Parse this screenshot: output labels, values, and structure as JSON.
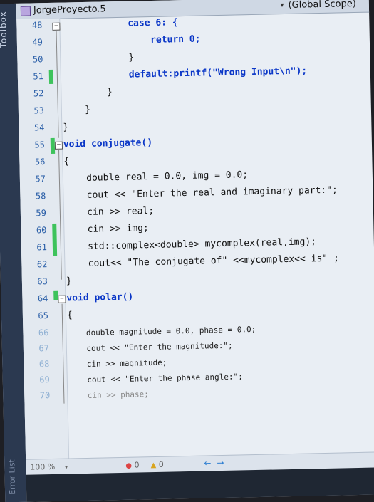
{
  "toolbox": {
    "label": "Toolbox",
    "secondary_label": "Error List"
  },
  "header": {
    "project": "JorgeProyecto.5",
    "scope": "(Global Scope)"
  },
  "gutter": {
    "line_numbers": [
      "48",
      "49",
      "50",
      "51",
      "52",
      "53",
      "54",
      "55",
      "56",
      "57",
      "58",
      "59",
      "60",
      "61",
      "62",
      "63",
      "64",
      "65",
      "66",
      "67",
      "68",
      "69",
      "70"
    ]
  },
  "code": {
    "lines": [
      [
        "            ",
        "case 6: {",
        ""
      ],
      [
        "                ",
        "return 0;",
        ""
      ],
      [
        "            ",
        "}",
        ""
      ],
      [
        "            ",
        "default:printf(\"Wrong Input\\n\");",
        ""
      ],
      [
        "        ",
        "}",
        ""
      ],
      [
        "    ",
        "}",
        ""
      ],
      [
        "",
        "}",
        ""
      ],
      [
        "",
        "void conjugate()",
        ""
      ],
      [
        "",
        "{",
        ""
      ],
      [
        "    ",
        "double real = 0.0, img = 0.0;",
        ""
      ],
      [
        "    ",
        "cout << \"Enter the real and imaginary part:\";",
        ""
      ],
      [
        "    ",
        "cin >> real;",
        ""
      ],
      [
        "    ",
        "cin >> img;",
        ""
      ],
      [
        "    ",
        "std::complex<double> mycomplex(real,img);",
        ""
      ],
      [
        "    ",
        "cout<< \"The conjugate of\" <<mycomplex<< is\" ;",
        ""
      ],
      [
        "",
        "}",
        ""
      ],
      [
        "",
        "void polar()",
        ""
      ],
      [
        "",
        "{",
        ""
      ],
      [
        "    ",
        "double magnitude = 0.0, phase = 0.0;",
        ""
      ],
      [
        "    ",
        "cout << \"Enter the magnitude:\";",
        ""
      ],
      [
        "    ",
        "cin >> magnitude;",
        ""
      ],
      [
        "    ",
        "cout << \"Enter the phase angle:\";",
        ""
      ],
      [
        "    ",
        "cin >> phase;",
        ""
      ]
    ]
  },
  "statusbar": {
    "zoom": "100 %",
    "errors": "0",
    "warnings": "0",
    "back": "←",
    "forward": "→"
  },
  "colors": {
    "keyword": "#0a36c7",
    "string": "#a31515",
    "change_marker": "#3ec35c",
    "line_number": "#2b5fa8"
  }
}
